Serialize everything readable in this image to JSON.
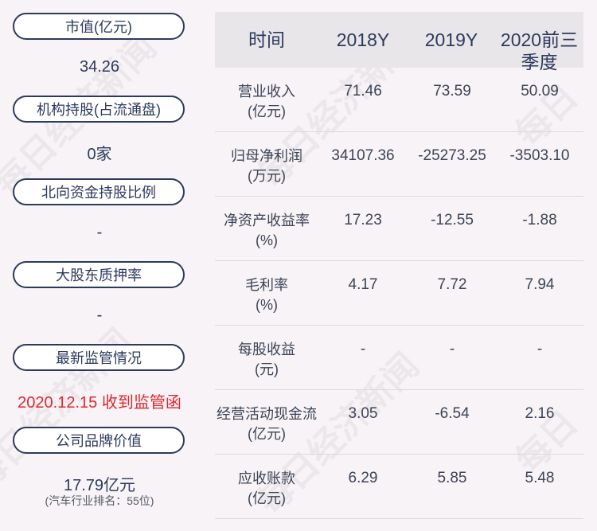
{
  "left_panel": {
    "market_cap_label": "市值(亿元)",
    "market_cap_value": "34.26",
    "institution_label": "机构持股(占流通盘)",
    "institution_value": "0家",
    "northbound_label": "北向资金持股比例",
    "northbound_value": "-",
    "pledge_label": "大股东质押率",
    "pledge_value": "-",
    "regulation_label": "最新监管情况",
    "regulation_value": "2020.12.15 收到监管函",
    "brand_label": "公司品牌价值",
    "brand_value": "17.79亿元",
    "brand_rank": "(汽车行业排名：55位)"
  },
  "table": {
    "headers": [
      "时间",
      "2018Y",
      "2019Y",
      "2020前三季度"
    ],
    "rows": [
      {
        "label1": "营业收入",
        "label2": "(亿元)",
        "values": [
          "71.46",
          "73.59",
          "50.09"
        ]
      },
      {
        "label1": "归母净利润",
        "label2": "(万元)",
        "values": [
          "34107.36",
          "-25273.25",
          "-3503.10"
        ]
      },
      {
        "label1": "净资产收益率",
        "label2": "(%)",
        "values": [
          "17.23",
          "-12.55",
          "-1.88"
        ]
      },
      {
        "label1": "毛利率",
        "label2": "(%)",
        "values": [
          "4.17",
          "7.72",
          "7.94"
        ]
      },
      {
        "label1": "每股收益",
        "label2": "(元)",
        "values": [
          "-",
          "-",
          "-"
        ]
      },
      {
        "label1": "经营活动现金流",
        "label2": "(亿元)",
        "values": [
          "3.05",
          "-6.54",
          "2.16"
        ]
      },
      {
        "label1": "应收账款",
        "label2": "(亿元)",
        "values": [
          "6.29",
          "5.85",
          "5.48"
        ]
      }
    ]
  },
  "watermark": "每日经济新闻",
  "colors": {
    "background": "#f7f3f6",
    "text": "#2c3a5c",
    "highlight": "#e0262f",
    "header_bg": "#e9e6e9"
  }
}
